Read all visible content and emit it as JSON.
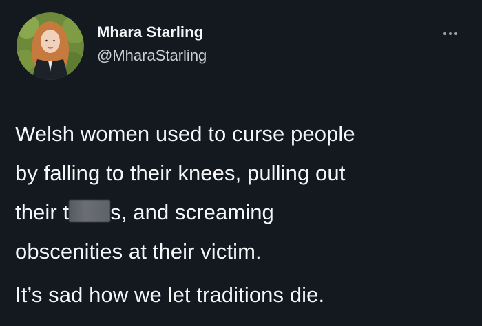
{
  "tweet": {
    "author": {
      "name": "Mhara Starling",
      "handle": "@MharaStarling",
      "avatar_icon": "profile-photo-avatar"
    },
    "more_icon": "more-options-ellipsis-icon",
    "body": {
      "line1": "Welsh women used to curse people",
      "line2": "by falling to their knees, pulling out",
      "line3_before": "their t",
      "line3_after": "s, and screaming",
      "line4": "obscenities at their victim.",
      "paragraph2": "It’s sad how we let traditions die."
    }
  },
  "colors": {
    "background": "#141920",
    "text": "#f4f6f8",
    "handle": "#c9d1d9",
    "redaction": "#62666b"
  }
}
